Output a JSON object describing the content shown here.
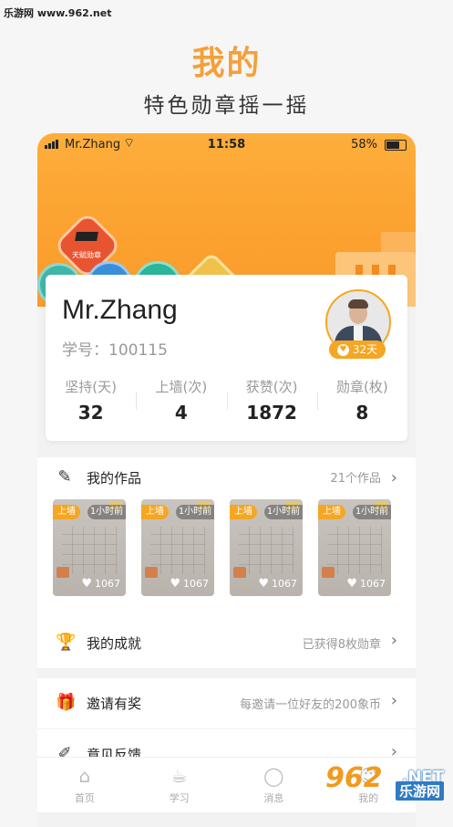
{
  "watermark_top": "乐游网 www.962.net",
  "hero": {
    "title": "我的",
    "subtitle": "特色勋章摇一摇"
  },
  "status_bar": {
    "carrier": "Mr.Zhang",
    "time": "11:58",
    "battery": "58%"
  },
  "profile": {
    "name": "Mr.Zhang",
    "student_id": "学号：100115",
    "days_badge": "32天",
    "stats": [
      {
        "label": "坚持(天)",
        "value": "32"
      },
      {
        "label": "上墙(次)",
        "value": "4"
      },
      {
        "label": "获赞(次)",
        "value": "1872"
      },
      {
        "label": "勋章(枚)",
        "value": "8"
      }
    ]
  },
  "badge_deco_text": "天赋勋章",
  "works": {
    "title": "我的作品",
    "count": "21个作品",
    "items": [
      {
        "tag": "上墙",
        "time": "1小时前",
        "likes": "1067"
      },
      {
        "tag": "上墙",
        "time": "1小时前",
        "likes": "1067"
      },
      {
        "tag": "上墙",
        "time": "1小时前",
        "likes": "1067"
      },
      {
        "tag": "上墙",
        "time": "1小时前",
        "likes": "1067"
      }
    ]
  },
  "achievements": {
    "title": "我的成就",
    "extra": "已获得8枚勋章"
  },
  "invite": {
    "title": "邀请有奖",
    "extra": "每邀请一位好友的200象币"
  },
  "feedback": {
    "title": "意见反馈"
  },
  "tabs": [
    {
      "label": "首页",
      "icon": "home-icon"
    },
    {
      "label": "学习",
      "icon": "cup-icon"
    },
    {
      "label": "消息",
      "icon": "message-icon"
    },
    {
      "label": "我的",
      "icon": "profile-icon"
    }
  ],
  "watermark_logo": {
    "big": "962",
    "net": ".NET",
    "small": "乐游网"
  },
  "colors": {
    "accent": "#f5a623",
    "header": "#fca12f"
  }
}
